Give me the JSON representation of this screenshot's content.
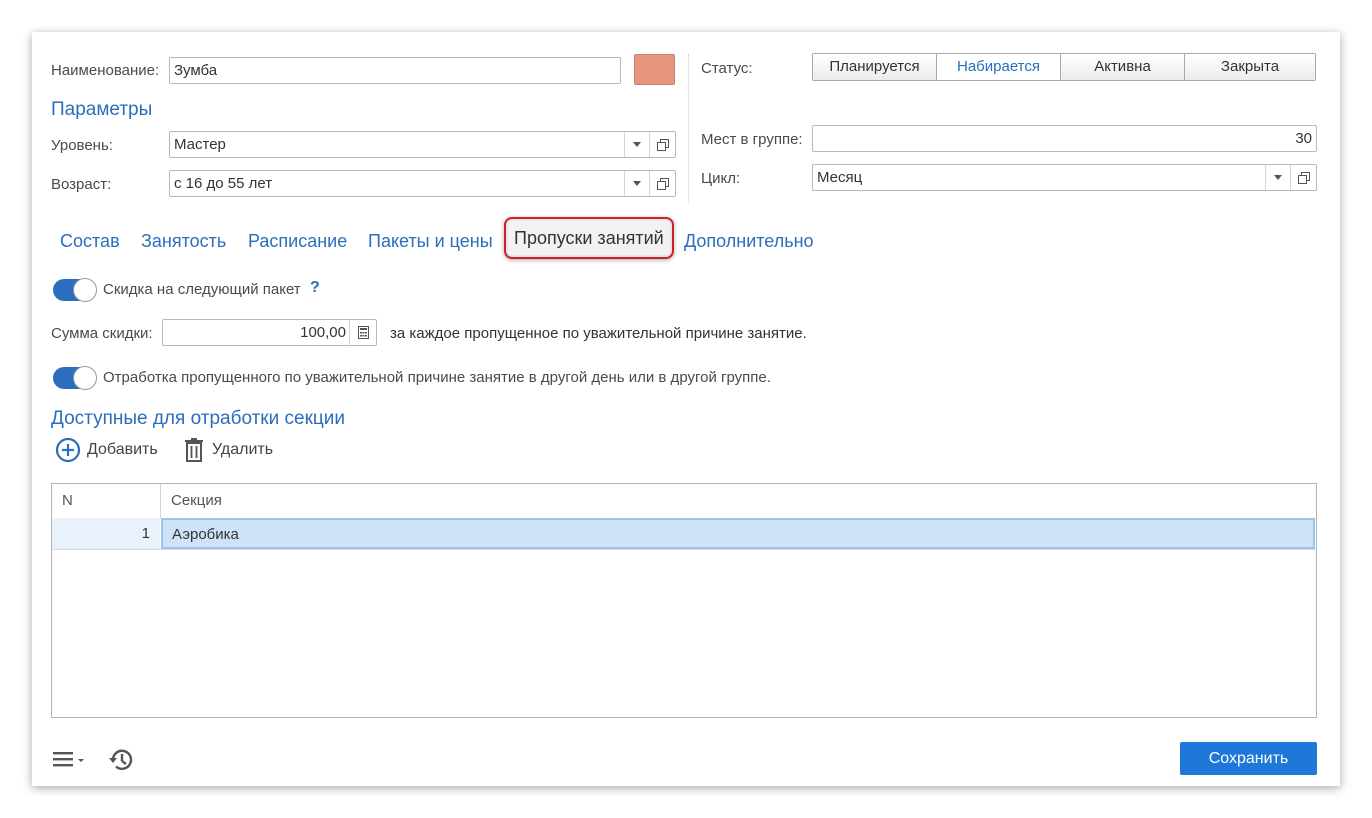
{
  "form": {
    "name_label": "Наименование:",
    "name_value": "Зумба",
    "color_swatch": "#e8957e",
    "status_label": "Статус:",
    "statuses": [
      "Планируется",
      "Набирается",
      "Активна",
      "Закрыта"
    ],
    "active_status": "Набирается"
  },
  "params": {
    "title": "Параметры",
    "level_label": "Уровень:",
    "level_value": "Мастер",
    "age_label": "Возраст:",
    "age_value": "с 16 до 55 лет",
    "seats_label": "Мест в группе:",
    "seats_value": "30",
    "cycle_label": "Цикл:",
    "cycle_value": "Месяц"
  },
  "tabs": [
    "Состав",
    "Занятость",
    "Расписание",
    "Пакеты и цены",
    "Пропуски занятий",
    "Дополнительно"
  ],
  "current_tab": "Пропуски занятий",
  "absence": {
    "discount_toggle_label": "Скидка на следующий пакет",
    "help_mark": "?",
    "discount_sum_label": "Сумма скидки:",
    "discount_sum_value": "100,00",
    "discount_suffix": "за каждое пропущенное по уважительной причине занятие.",
    "makeup_toggle_label": "Отработка пропущенного по уважительной причине занятие в другой день или в другой группе.",
    "sections_title": "Доступные для отработки секции",
    "add_label": "Добавить",
    "delete_label": "Удалить"
  },
  "table": {
    "headers": [
      "N",
      "Секция"
    ],
    "rows": [
      {
        "n": "1",
        "section": "Аэробика"
      }
    ]
  },
  "footer": {
    "save_label": "Сохранить"
  },
  "colors": {
    "accent": "#2a6ebd",
    "save_button": "#1e78d8",
    "highlight_border": "#cf2027"
  }
}
